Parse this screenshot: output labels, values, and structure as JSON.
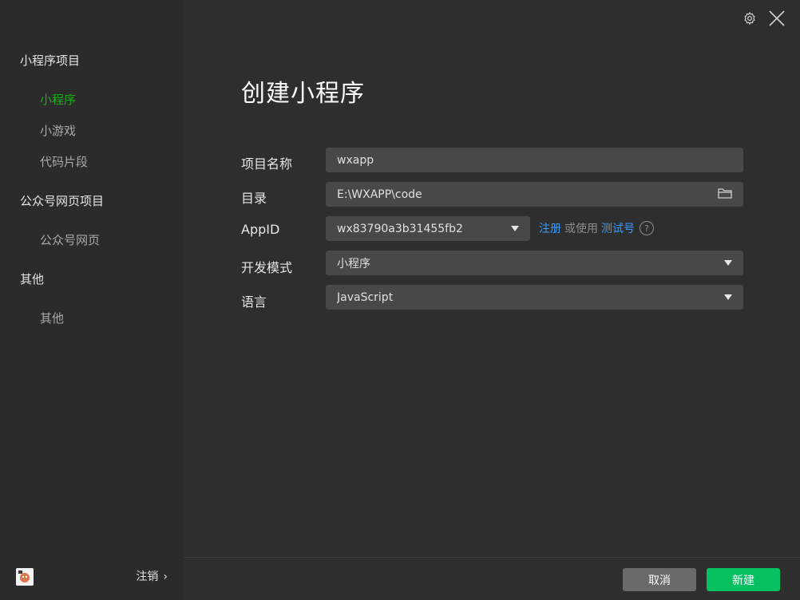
{
  "sidebar": {
    "groups": [
      {
        "title": "小程序项目",
        "items": [
          {
            "label": "小程序",
            "active": true
          },
          {
            "label": "小游戏"
          },
          {
            "label": "代码片段"
          }
        ]
      },
      {
        "title": "公众号网页项目",
        "items": [
          {
            "label": "公众号网页"
          }
        ]
      },
      {
        "title": "其他",
        "items": [
          {
            "label": "其他"
          }
        ]
      }
    ],
    "footer": {
      "logout_label": "注销",
      "logout_chevron": "›"
    }
  },
  "main": {
    "title": "创建小程序",
    "form": {
      "project_name": {
        "label": "项目名称",
        "value": "wxapp"
      },
      "directory": {
        "label": "目录",
        "value": "E:\\WXAPP\\code"
      },
      "appid": {
        "label": "AppID",
        "value": "wx83790a3b31455fb2",
        "register_link": "注册",
        "or_use": "或使用",
        "test_link": "测试号",
        "help": "?"
      },
      "dev_mode": {
        "label": "开发模式",
        "value": "小程序"
      },
      "language": {
        "label": "语言",
        "value": "JavaScript"
      }
    }
  },
  "footer": {
    "cancel_label": "取消",
    "create_label": "新建"
  },
  "colors": {
    "accent_green": "#1aad19",
    "button_green": "#07c160",
    "link_blue": "#3b9cff"
  }
}
